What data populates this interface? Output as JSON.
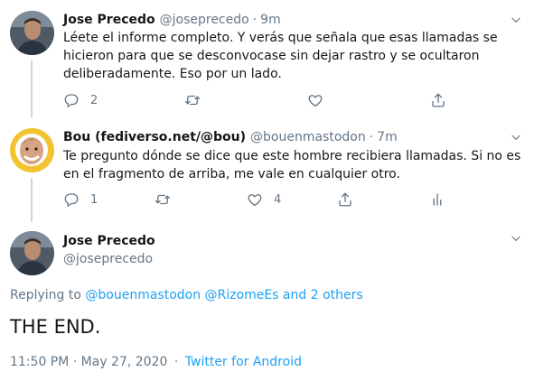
{
  "tweets": [
    {
      "name": "Jose Precedo",
      "handle": "@joseprecedo",
      "separator": "·",
      "time": "9m",
      "text": "Léete el informe completo. Y verás que señala que esas llamadas se hicieron para que se desconvocase sin dejar rastro y se ocultaron deliberadamente. Eso por un lado.",
      "reply_count": "2"
    },
    {
      "name": "Bou (fediverso.net/@bou)",
      "handle": "@bouenmastodon",
      "separator": "·",
      "time": "7m",
      "text": "Te pregunto dónde se dice que este hombre recibiera llamadas. Si no es en el fragmento de arriba, me vale en cualquier otro.",
      "reply_count": "1",
      "like_count": "4"
    }
  ],
  "main_tweet": {
    "name": "Jose Precedo",
    "handle": "@joseprecedo",
    "replying_prefix": "Replying to",
    "replying_users": "@bouenmastodon @RizomeEs",
    "replying_others": "and 2 others",
    "text": "THE END.",
    "timestamp": "11:50 PM · May 27, 2020",
    "dot": "·",
    "client": "Twitter for Android"
  },
  "colors": {
    "accent": "#1da1f2",
    "muted": "#657786",
    "text": "#14171a",
    "line": "#ccd6dd"
  },
  "icons": [
    "chevron-down-icon",
    "reply-icon",
    "retweet-icon",
    "like-icon",
    "share-icon",
    "analytics-icon"
  ]
}
